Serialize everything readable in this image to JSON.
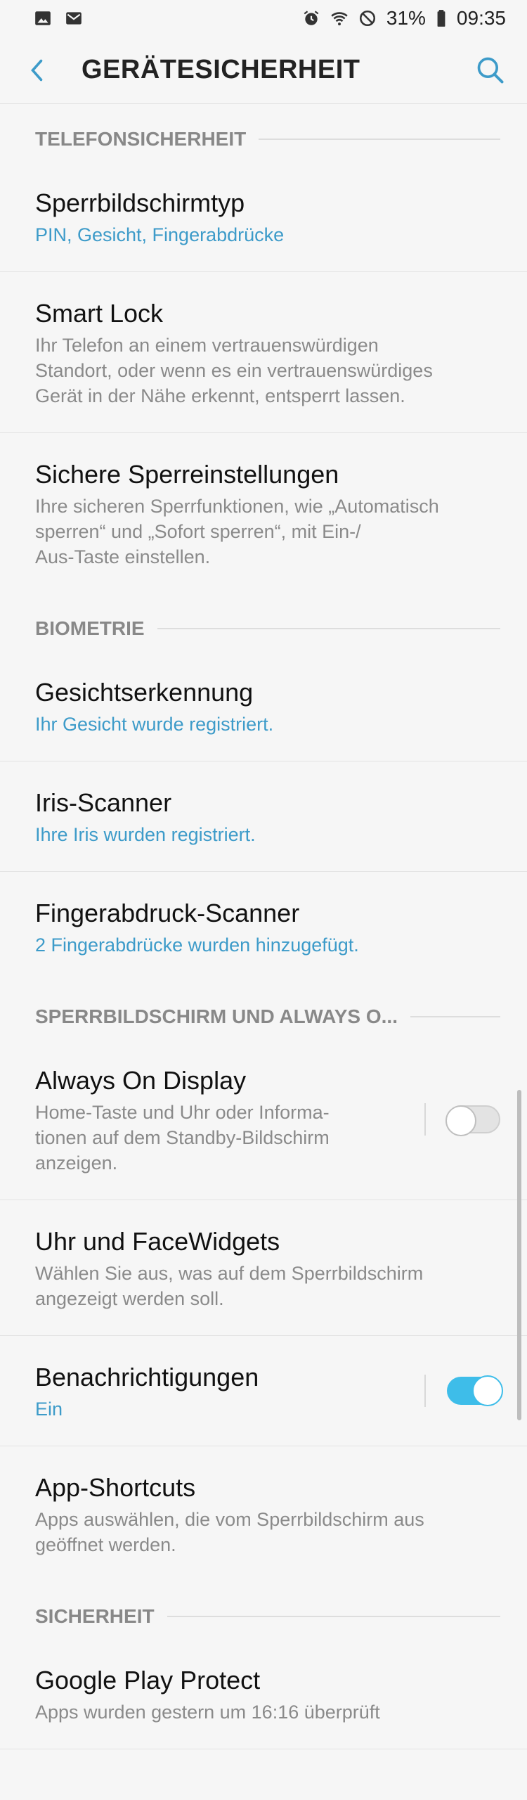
{
  "status_bar": {
    "battery": "31%",
    "time": "09:35",
    "icons": [
      "image-icon",
      "mail-icon",
      "alarm-icon",
      "wifi-icon",
      "do-not-disturb-icon",
      "battery-icon"
    ]
  },
  "app_bar": {
    "title": "GERÄTESICHERHEIT",
    "back_icon": "chevron-left-icon",
    "search_icon": "search-icon"
  },
  "sections": {
    "telefon": {
      "header": "TELEFONSICHERHEIT"
    },
    "bio": {
      "header": "BIOMETRIE"
    },
    "lock": {
      "header": "SPERRBILDSCHIRM UND ALWAYS O..."
    },
    "sec": {
      "header": "SICHERHEIT"
    }
  },
  "items": {
    "sperrtyp": {
      "title": "Sperrbildschirmtyp",
      "sub": "PIN, Gesicht, Fingerabdrücke"
    },
    "smartlock": {
      "title": "Smart Lock",
      "sub": "Ihr Telefon an einem vertrauenswürdigen\nStandort, oder wenn es ein vertrauenswürdiges\nGerät in der Nähe erkennt, entsperrt lassen."
    },
    "sichere": {
      "title": "Sichere Sperreinstellungen",
      "sub": "Ihre sicheren Sperrfunktionen, wie „Automatisch\nsperren“ und „Sofort sperren“, mit Ein-/\nAus-Taste einstellen."
    },
    "gesicht": {
      "title": "Gesichtserkennung",
      "sub": "Ihr Gesicht wurde registriert."
    },
    "iris": {
      "title": "Iris-Scanner",
      "sub": "Ihre Iris wurden registriert."
    },
    "finger": {
      "title": "Fingerabdruck-Scanner",
      "sub": "2 Fingerabdrücke wurden hinzugefügt."
    },
    "aod": {
      "title": "Always On Display",
      "sub": "Home-Taste und Uhr oder Informa-\ntionen auf dem Standby-Bildschirm\nanzeigen.",
      "toggle": "off"
    },
    "uhr": {
      "title": "Uhr und FaceWidgets",
      "sub": "Wählen Sie aus, was auf dem Sperrbildschirm\nangezeigt werden soll."
    },
    "benach": {
      "title": "Benachrichtigungen",
      "sub": "Ein",
      "toggle": "on"
    },
    "shortcuts": {
      "title": "App-Shortcuts",
      "sub": "Apps auswählen, die vom Sperrbildschirm aus\ngeöffnet werden."
    },
    "gpp": {
      "title": "Google Play Protect",
      "sub": "Apps wurden gestern um 16:16 überprüft"
    }
  },
  "colors": {
    "accent": "#3d9bc9",
    "toggle_on": "#3ebde9",
    "background": "#f6f6f6"
  }
}
